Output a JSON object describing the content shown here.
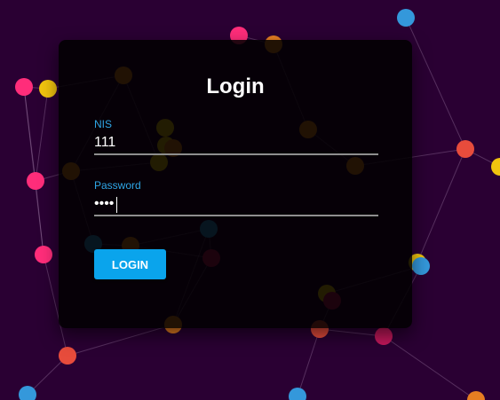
{
  "login": {
    "title": "Login",
    "nis_label": "NIS",
    "nis_value": "111",
    "password_label": "Password",
    "password_value": "1111",
    "submit_label": "LOGIN"
  },
  "background": {
    "color": "#2a0033",
    "node_colors": [
      "#ff2d7a",
      "#f1c40f",
      "#e74c3c",
      "#3498db",
      "#e67e22",
      "#c2185b"
    ]
  }
}
